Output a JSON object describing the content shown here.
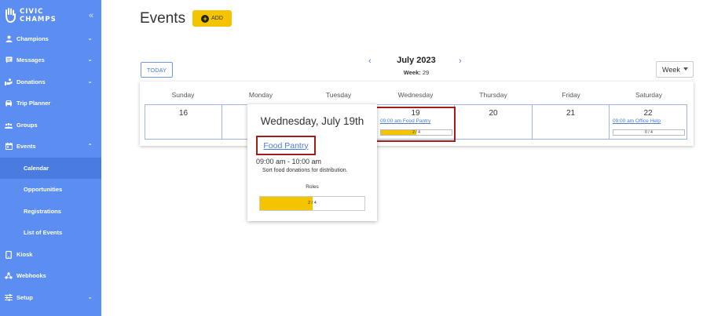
{
  "brand": {
    "line1": "CIVIC",
    "line2": "CHAMPS"
  },
  "sidebar": {
    "collapse_glyph": "«",
    "items": [
      {
        "label": "Champions",
        "icon": "person-icon",
        "chevron": "expand"
      },
      {
        "label": "Messages",
        "icon": "message-icon",
        "chevron": "expand"
      },
      {
        "label": "Donations",
        "icon": "donation-icon",
        "chevron": "expand"
      },
      {
        "label": "Trip Planner",
        "icon": "car-icon"
      },
      {
        "label": "Groups",
        "icon": "groups-icon"
      },
      {
        "label": "Events",
        "icon": "calendar-icon",
        "chevron": "collapse"
      },
      {
        "label": "Kiosk",
        "icon": "tablet-icon"
      },
      {
        "label": "Webhooks",
        "icon": "webhooks-icon"
      },
      {
        "label": "Setup",
        "icon": "setup-icon",
        "chevron": "expand"
      }
    ],
    "sub_items": [
      {
        "label": "Calendar",
        "active": true
      },
      {
        "label": "Opportunities"
      },
      {
        "label": "Registrations"
      },
      {
        "label": "List of Events"
      }
    ]
  },
  "header": {
    "title": "Events",
    "add_label": "ADD"
  },
  "toolbar": {
    "today_label": "TODAY",
    "month": "July 2023",
    "week_prefix": "Week:",
    "week_number": "29",
    "view": "Week"
  },
  "calendar": {
    "days": [
      {
        "name": "Sunday",
        "date": "16"
      },
      {
        "name": "Monday",
        "date": ""
      },
      {
        "name": "Tuesday",
        "date": ""
      },
      {
        "name": "Wednesday",
        "date": "19",
        "event": "09:00 am Food Pantry",
        "fill": "2 / 4",
        "fill_fraction": 0.5
      },
      {
        "name": "Thursday",
        "date": "20"
      },
      {
        "name": "Friday",
        "date": "21"
      },
      {
        "name": "Saturday",
        "date": "22",
        "event": "09:00 am Office Help",
        "fill": "0 / 4",
        "fill_fraction": 0
      }
    ]
  },
  "popover": {
    "title": "Wednesday, July 19th",
    "event_name": "Food Pantry",
    "time": "09:00 am - 10:00 am",
    "description": "Sort food donations for distribution.",
    "roles_label": "Roles",
    "fill_text": "2 / 4",
    "fill_fraction": 0.5
  },
  "colors": {
    "sidebar": "#5b8ef0",
    "accent": "#f5c400",
    "highlight": "#a31c1c",
    "link": "#4c7bd6"
  }
}
